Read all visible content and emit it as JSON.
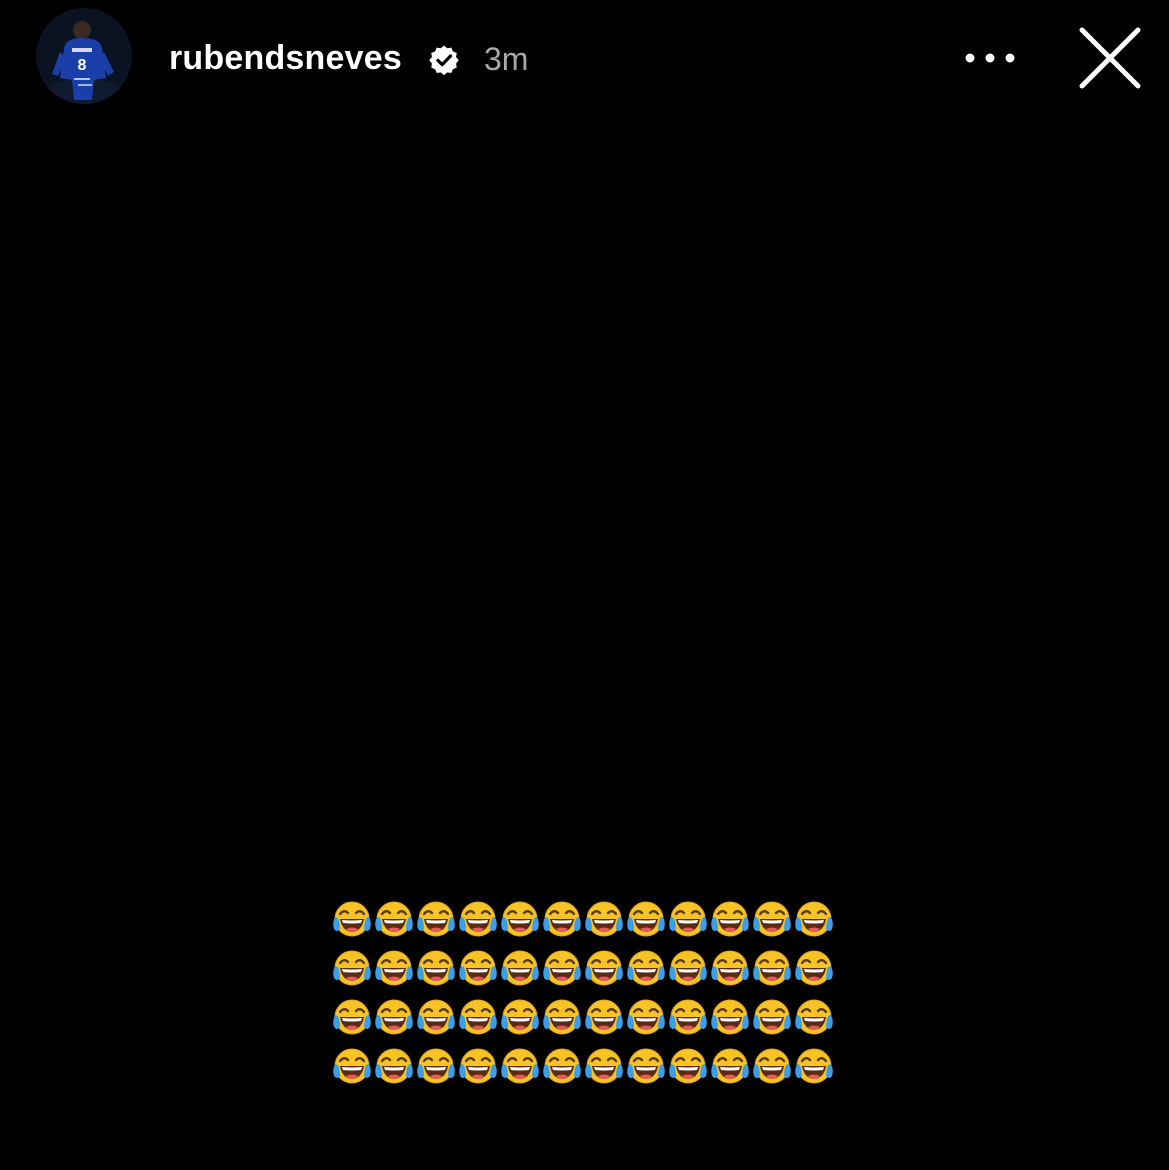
{
  "story": {
    "username": "rubendsneves",
    "verified": true,
    "timestamp": "3m",
    "avatar_description_icon": "profile-avatar",
    "menu_icon": "more-horizontal-icon",
    "close_icon": "close-icon"
  },
  "content": {
    "background_color": "#000000",
    "emoji": "😂",
    "emoji_name": "face-with-tears-of-joy",
    "rows": 4,
    "per_row": 12
  },
  "colors": {
    "text_primary": "#ffffff",
    "text_secondary": "#a8a8a8",
    "emoji_yellow": "#f7c325",
    "emoji_tear": "#3d9ee8"
  }
}
